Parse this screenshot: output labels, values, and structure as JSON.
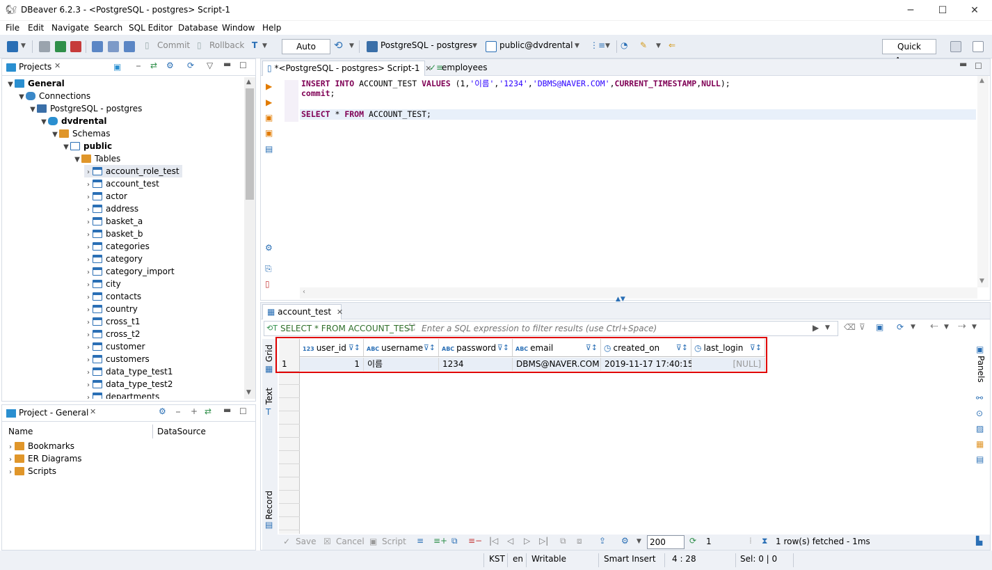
{
  "window": {
    "title": "DBeaver 6.2.3 - <PostgreSQL - postgres> Script-1"
  },
  "menu": [
    "File",
    "Edit",
    "Navigate",
    "Search",
    "SQL Editor",
    "Database",
    "Window",
    "Help"
  ],
  "toolbar": {
    "commit_label": "Commit",
    "rollback_label": "Rollback",
    "tx_mode": "Auto",
    "connection": "PostgreSQL - postgres",
    "schema": "public@dvdrental",
    "quick_access": "Quick Access"
  },
  "projects": {
    "tab_label": "Projects",
    "tree": {
      "root": "General",
      "connections": "Connections",
      "connection": "PostgreSQL - postgres",
      "database": "dvdrental",
      "schemas": "Schemas",
      "schema": "public",
      "tables_label": "Tables",
      "tables": [
        "account_role_test",
        "account_test",
        "actor",
        "address",
        "basket_a",
        "basket_b",
        "categories",
        "category",
        "category_import",
        "city",
        "contacts",
        "country",
        "cross_t1",
        "cross_t2",
        "customer",
        "customers",
        "data_type_test1",
        "data_type_test2",
        "departments"
      ]
    }
  },
  "project_general": {
    "tab_label": "Project - General",
    "col_name": "Name",
    "col_datasource": "DataSource",
    "items": [
      "Bookmarks",
      "ER Diagrams",
      "Scripts"
    ]
  },
  "editor": {
    "tab_script": "*<PostgreSQL - postgres> Script-1",
    "tab_employees": "employees",
    "lines": [
      {
        "kw1": "INSERT INTO",
        "text1": " ACCOUNT_TEST ",
        "kw2": "VALUES",
        "text2": " (1,",
        "s1": "'이름'",
        "c1": ",",
        "s2": "'1234'",
        "c2": ",",
        "s3": "'DBMS@NAVER.COM'",
        "text3": ",",
        "kw3": "CURRENT_TIMESTAMP",
        "c3": ",",
        "kw4": "NULL",
        "text4": ");"
      },
      {
        "kw1": "commit",
        "text1": ";"
      },
      {
        "kw1": "SELECT",
        "text1": " * ",
        "kw2": "FROM",
        "text2": " ACCOUNT_TEST;"
      }
    ]
  },
  "results": {
    "tab_label": "account_test",
    "query_label": "SELECT * FROM ACCOUNT_TEST",
    "filter_placeholder": "Enter a SQL expression to filter results (use Ctrl+Space)",
    "side_tabs": {
      "grid": "Grid",
      "text": "Text",
      "record": "Record",
      "panels": "Panels"
    },
    "columns": [
      {
        "type": "123",
        "name": "user_id"
      },
      {
        "type": "ABC",
        "name": "username"
      },
      {
        "type": "ABC",
        "name": "password"
      },
      {
        "type": "ABC",
        "name": "email"
      },
      {
        "type": "clock",
        "name": "created_on"
      },
      {
        "type": "clock",
        "name": "last_login"
      }
    ],
    "rows": [
      {
        "num": "1",
        "cells": [
          "1",
          "이름",
          "1234",
          "DBMS@NAVER.COM",
          "2019-11-17 17:40:15",
          "[NULL]"
        ]
      }
    ],
    "bottom": {
      "save": "Save",
      "cancel": "Cancel",
      "script": "Script",
      "fetch_size": "200",
      "refresh_count": "1",
      "status": "1 row(s) fetched - 1ms"
    }
  },
  "statusbar": {
    "timezone": "KST",
    "locale": "en",
    "mode": "Writable",
    "insert": "Smart Insert",
    "position": "4 : 28",
    "selection": "Sel: 0 | 0"
  }
}
